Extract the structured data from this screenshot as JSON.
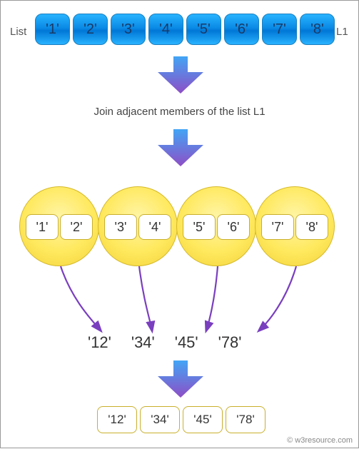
{
  "labels": {
    "list": "List",
    "l1": "L1",
    "caption": "Join adjacent members of the list L1",
    "credit": "© w3resource.com"
  },
  "top_items": [
    "'1'",
    "'2'",
    "'3'",
    "'4'",
    "'5'",
    "'6'",
    "'7'",
    "'8'"
  ],
  "circle_pairs": [
    [
      "'1'",
      "'2'"
    ],
    [
      "'3'",
      "'4'"
    ],
    [
      "'5'",
      "'6'"
    ],
    [
      "'7'",
      "'8'"
    ]
  ],
  "results": [
    "'12'",
    "'34'",
    "'45'",
    "'78'"
  ],
  "bottom_items": [
    "'12'",
    "'34'",
    "'45'",
    "'78'"
  ],
  "colors": {
    "blue_cell": "#1fa0f2",
    "yellow": "#ffe95e",
    "arrow_top": "#42a5f5",
    "arrow_bottom": "#8e4ec6",
    "curve": "#7a3fbf"
  }
}
